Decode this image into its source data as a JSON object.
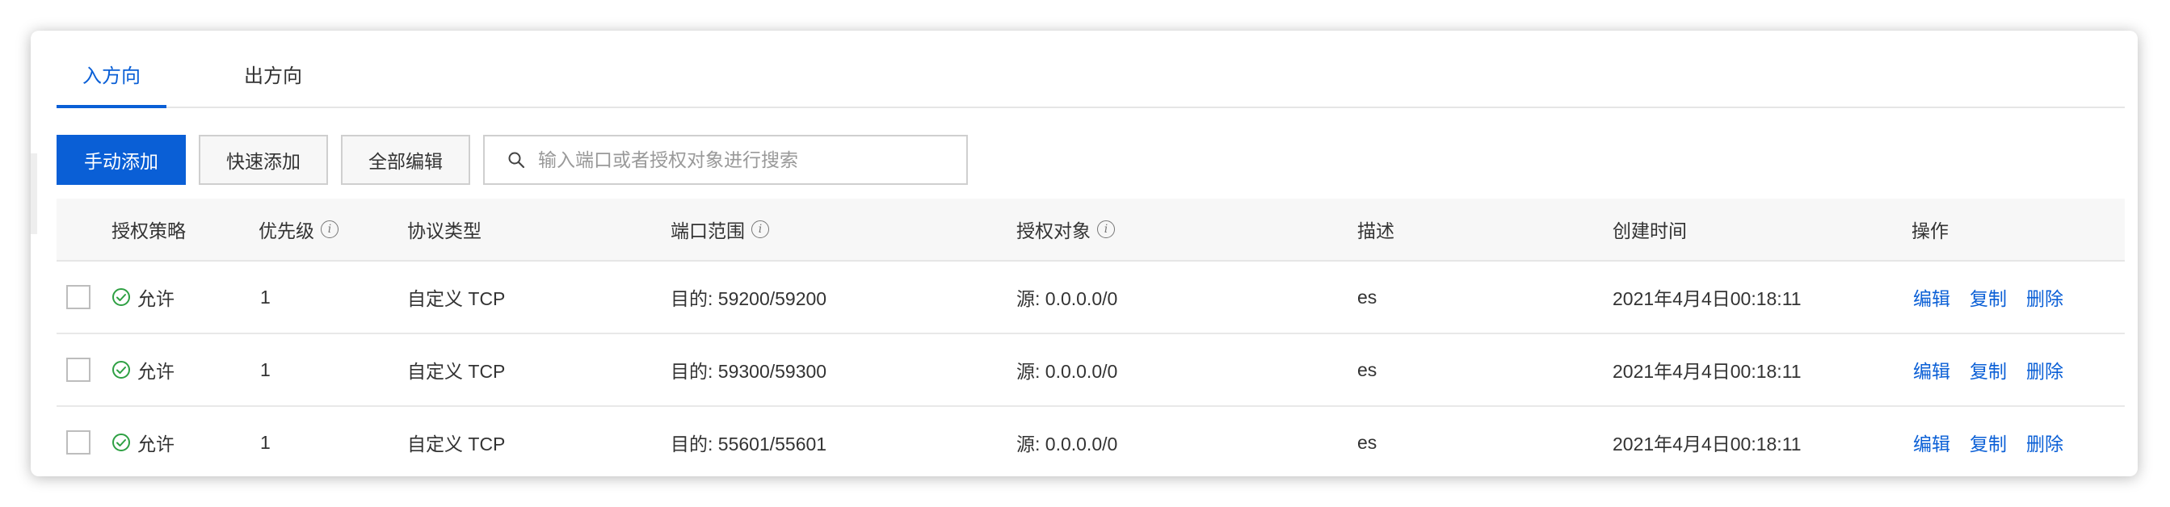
{
  "tabs": [
    {
      "label": "入方向",
      "active": true
    },
    {
      "label": "出方向",
      "active": false
    }
  ],
  "toolbar": {
    "manual_add": "手动添加",
    "quick_add": "快速添加",
    "edit_all": "全部编辑",
    "search_placeholder": "输入端口或者授权对象进行搜索"
  },
  "table": {
    "headers": {
      "policy": "授权策略",
      "priority": "优先级",
      "protocol": "协议类型",
      "port_range": "端口范围",
      "auth_object": "授权对象",
      "description": "描述",
      "created": "创建时间",
      "actions": "操作"
    },
    "rows": [
      {
        "policy": "允许",
        "priority": "1",
        "protocol": "自定义 TCP",
        "port_range": "目的: 59200/59200",
        "auth_object": "源: 0.0.0.0/0",
        "description": "es",
        "created": "2021年4月4日00:18:11"
      },
      {
        "policy": "允许",
        "priority": "1",
        "protocol": "自定义 TCP",
        "port_range": "目的: 59300/59300",
        "auth_object": "源: 0.0.0.0/0",
        "description": "es",
        "created": "2021年4月4日00:18:11"
      },
      {
        "policy": "允许",
        "priority": "1",
        "protocol": "自定义 TCP",
        "port_range": "目的: 55601/55601",
        "auth_object": "源: 0.0.0.0/0",
        "description": "es",
        "created": "2021年4月4日00:18:11"
      }
    ],
    "actions": {
      "edit": "编辑",
      "copy": "复制",
      "delete": "删除"
    }
  },
  "colors": {
    "accent": "#0a5fd6",
    "allow": "#2ea043"
  }
}
